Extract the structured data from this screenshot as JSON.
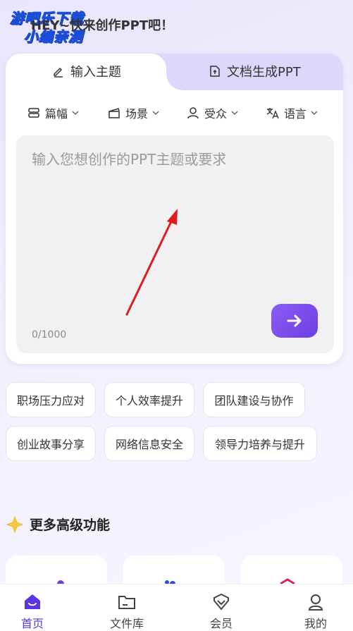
{
  "watermark": {
    "line1": "游吧乐下载",
    "line2": "小编亲测"
  },
  "greeting": "HEY~快来创作PPT吧！",
  "tabs": [
    {
      "label": "输入主题",
      "icon": "pen-icon",
      "active": true
    },
    {
      "label": "文档生成PPT",
      "icon": "upload-file-icon",
      "active": false
    }
  ],
  "options": [
    {
      "label": "篇幅",
      "icon": "length-icon"
    },
    {
      "label": "场景",
      "icon": "clapperboard-icon"
    },
    {
      "label": "受众",
      "icon": "person-icon"
    },
    {
      "label": "语言",
      "icon": "translate-icon"
    }
  ],
  "input": {
    "placeholder": "输入您想创作的PPT主题或要求",
    "counter": "0/1000"
  },
  "suggestions": [
    "职场压力应对",
    "个人效率提升",
    "团队建设与协作",
    "创业故事分享",
    "网络信息安全",
    "领导力培养与提升"
  ],
  "more_features": {
    "title": "更多高级功能",
    "icon": "sparkle-star-icon"
  },
  "bottom_nav": [
    {
      "label": "首页",
      "icon": "home-icon",
      "active": true
    },
    {
      "label": "文件库",
      "icon": "folder-icon",
      "active": false
    },
    {
      "label": "会员",
      "icon": "member-icon",
      "active": false
    },
    {
      "label": "我的",
      "icon": "profile-icon",
      "active": false
    }
  ],
  "colors": {
    "accent": "#6d3fe0",
    "annotation_arrow": "#e01b1b"
  }
}
